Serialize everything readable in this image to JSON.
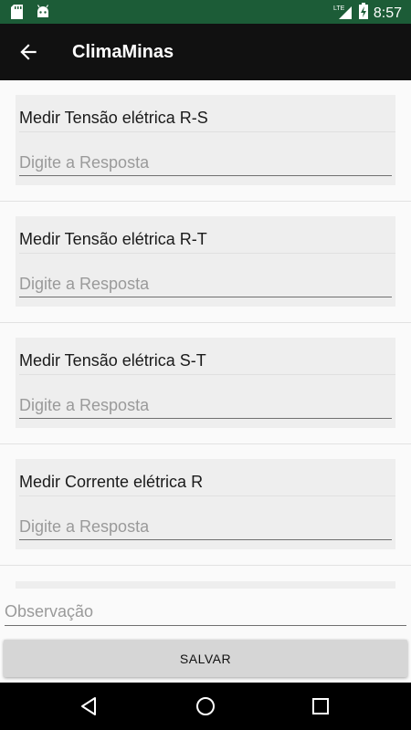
{
  "status_bar": {
    "time": "8:57",
    "network": "LTE",
    "icons": [
      "sd-card-icon",
      "android-icon",
      "signal-icon",
      "battery-charging-icon"
    ]
  },
  "app_bar": {
    "title": "ClimaMinas",
    "back_icon": "arrow-back-icon"
  },
  "questions": [
    {
      "label": "Medir Tensão elétrica R-S",
      "placeholder": "Digite a Resposta",
      "value": ""
    },
    {
      "label": "Medir Tensão elétrica R-T",
      "placeholder": "Digite a Resposta",
      "value": ""
    },
    {
      "label": "Medir Tensão elétrica S-T",
      "placeholder": "Digite a Resposta",
      "value": ""
    },
    {
      "label": "Medir Corrente elétrica R",
      "placeholder": "Digite a Resposta",
      "value": ""
    }
  ],
  "observation": {
    "placeholder": "Observação",
    "value": ""
  },
  "save_button": {
    "label": "SALVAR"
  },
  "nav_bar": {
    "icons": [
      "back-triangle-icon",
      "home-circle-icon",
      "recents-square-icon"
    ]
  },
  "colors": {
    "status_bar": "#1c5c37",
    "app_bar": "#111111",
    "card": "#eeeeee",
    "button": "#d6d6d6"
  }
}
